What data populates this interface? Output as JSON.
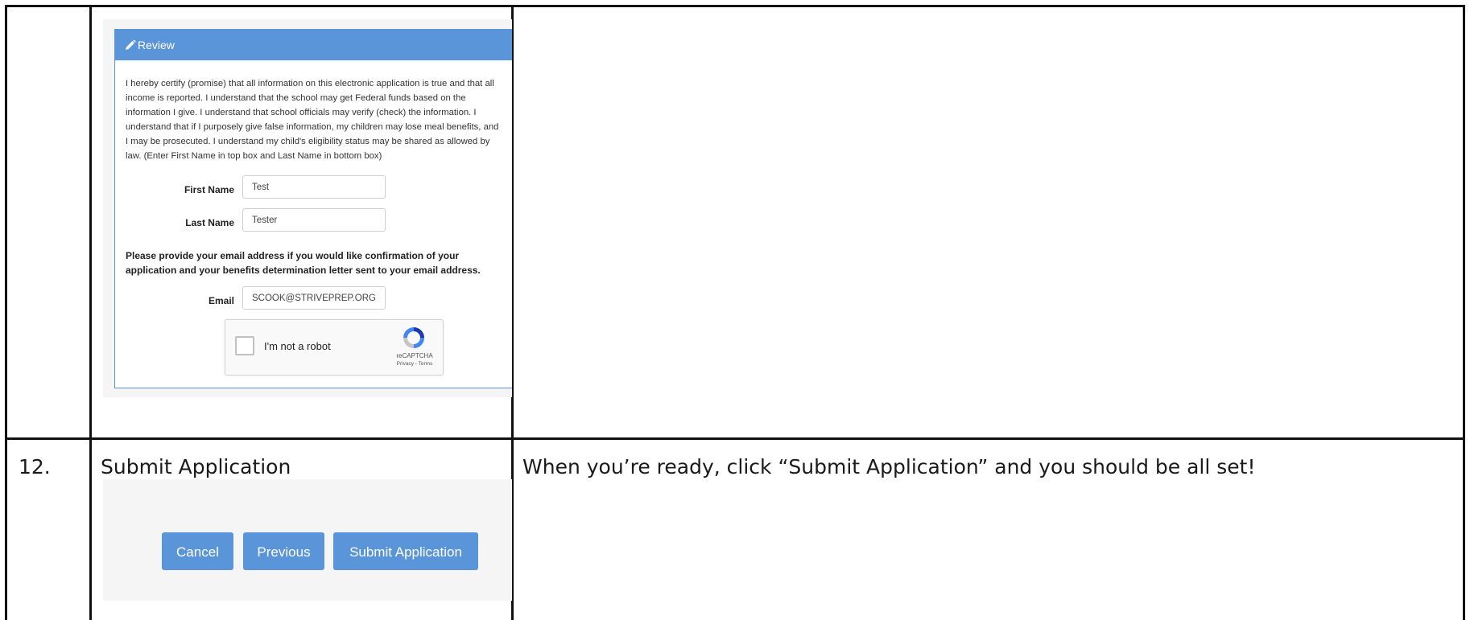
{
  "row12": {
    "number": "12.",
    "step_title": "Submit Application",
    "instruction": "When you’re ready, click “Submit Application” and you should be all set!"
  },
  "review": {
    "header": "Review",
    "certification": "I hereby certify (promise) that all information on this electronic application is true and that all income is reported. I understand that the school may get Federal funds based on the information I give. I understand that school officials may verify (check) the information. I understand that if I purposely give false information, my children may lose meal benefits, and I may be prosecuted. I understand my child's eligibility status may be shared as allowed by law. (Enter First Name in top box and Last Name in bottom box)",
    "first_name_label": "First Name",
    "first_name_value": "Test",
    "last_name_label": "Last Name",
    "last_name_value": "Tester",
    "email_note": "Please provide your email address if you would like confirmation of your application and your benefits determination letter sent to your email address.",
    "email_label": "Email",
    "email_value": "SCOOK@STRIVEPREP.ORG",
    "captcha": {
      "label": "I'm not a robot",
      "brand": "reCAPTCHA",
      "links": "Privacy - Terms"
    }
  },
  "buttons": {
    "cancel": "Cancel",
    "previous": "Previous",
    "submit": "Submit Application"
  },
  "colors": {
    "accent_blue": "#5b95d9",
    "border": "#111111"
  },
  "icons": [
    "pencil-icon",
    "recaptcha-logo-icon"
  ]
}
